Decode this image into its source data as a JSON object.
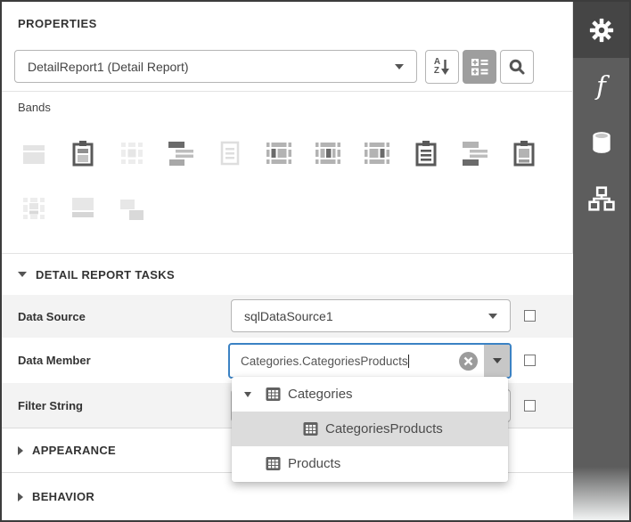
{
  "panel": {
    "title": "PROPERTIES"
  },
  "toolbar": {
    "selector_value": "DetailReport1 (Detail Report)",
    "sort_letters": {
      "a": "A",
      "z": "Z"
    },
    "buttons": [
      "sort-az",
      "category-view",
      "search"
    ],
    "active_button": "category-view"
  },
  "bands": {
    "label": "Bands",
    "icons_row1": [
      "top-margin",
      "report-header",
      "page-header",
      "group-header",
      "detail",
      "vertical-header",
      "vertical-detail",
      "vertical-total",
      "page-footer",
      "group-footer",
      "report-footer"
    ],
    "icons_row2": [
      "sub-band",
      "bottom-margin",
      "detail-report"
    ]
  },
  "tasks_section": {
    "title": "DETAIL REPORT TASKS",
    "expanded": true
  },
  "fields": {
    "data_source": {
      "label": "Data Source",
      "value": "sqlDataSource1"
    },
    "data_member": {
      "label": "Data Member",
      "value": "Categories.CategoriesProducts"
    },
    "filter_string": {
      "label": "Filter String",
      "value": ""
    }
  },
  "popup": {
    "items": [
      {
        "label": "Categories",
        "level": 0,
        "expanded": true,
        "selected": false
      },
      {
        "label": "CategoriesProducts",
        "level": 1,
        "expanded": null,
        "selected": true
      },
      {
        "label": "Products",
        "level": 0,
        "expanded": null,
        "selected": false
      }
    ]
  },
  "collapsed_sections": {
    "appearance": "APPEARANCE",
    "behavior": "BEHAVIOR"
  },
  "sidebar": {
    "tabs": [
      "properties-settings",
      "expressions",
      "field-list",
      "report-explorer"
    ],
    "active_tab": "properties-settings"
  },
  "colors": {
    "focus_border": "#3b82c4",
    "sidebar_bg": "#5d5d5d",
    "sidebar_active_bg": "#454545",
    "row_alt_bg": "#f3f3f3",
    "popup_selected_bg": "#dcdcdc",
    "enabled_icon": "#595959",
    "disabled_icon": "#e4e4e4"
  }
}
